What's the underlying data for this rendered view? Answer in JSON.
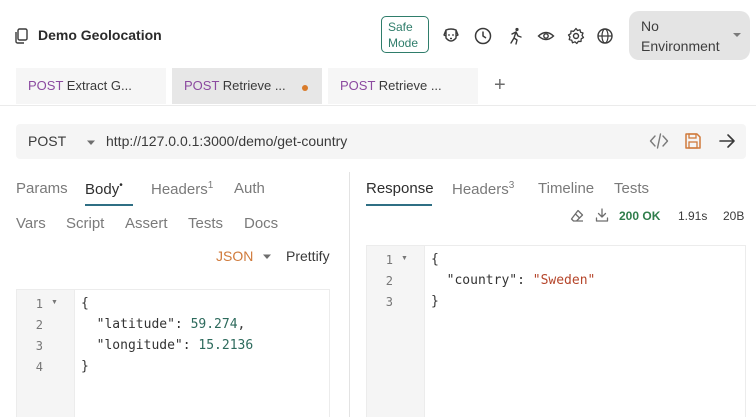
{
  "header": {
    "collection_title": "Demo Geolocation",
    "safe_mode_line1": "Safe",
    "safe_mode_line2": "Mode",
    "toolbar_icons": [
      "dog-icon",
      "clock-icon",
      "runner-icon",
      "eye-icon",
      "gear-icon",
      "globe-icon"
    ],
    "environment": "No Environment"
  },
  "tabs": [
    {
      "method": "POST",
      "name": "Extract G..."
    },
    {
      "method": "POST",
      "name": "Retrieve ...",
      "active": true,
      "unsaved": true
    },
    {
      "method": "POST",
      "name": "Retrieve ..."
    }
  ],
  "new_tab_label": "+",
  "request": {
    "method": "POST",
    "url": "http://127.0.0.1:3000/demo/get-country"
  },
  "request_tabs": {
    "params": "Params",
    "body": "Body",
    "body_marker": "•",
    "headers": "Headers",
    "headers_count": "1",
    "auth": "Auth",
    "vars": "Vars",
    "script": "Script",
    "assert": "Assert",
    "tests": "Tests",
    "docs": "Docs",
    "body_mode": "JSON",
    "prettify": "Prettify"
  },
  "request_body": {
    "line_numbers": [
      "1",
      "2",
      "3",
      "4"
    ],
    "lines": [
      {
        "plain": "{"
      },
      {
        "key": "  \"latitude\": ",
        "value": "59.274",
        "tail": ","
      },
      {
        "key": "  \"longitude\": ",
        "value": "15.2136",
        "tail": ""
      },
      {
        "plain": "}"
      }
    ]
  },
  "response_tabs": {
    "response": "Response",
    "headers": "Headers",
    "headers_count": "3",
    "timeline": "Timeline",
    "tests": "Tests"
  },
  "response_meta": {
    "status": "200 OK",
    "time": "1.91s",
    "size": "20B",
    "status_color": "#2f7d4b"
  },
  "response_body": {
    "line_numbers": [
      "1",
      "2",
      "3"
    ],
    "lines": [
      {
        "plain": "{"
      },
      {
        "key": "  \"country\": ",
        "value": "\"Sweden\""
      },
      {
        "plain": "}"
      }
    ]
  },
  "colors": {
    "accent": "#2f6f84",
    "method_purple": "#8c4aa0",
    "json_orange": "#d07a3b",
    "safe_mode_green": "#2f7d6b"
  }
}
